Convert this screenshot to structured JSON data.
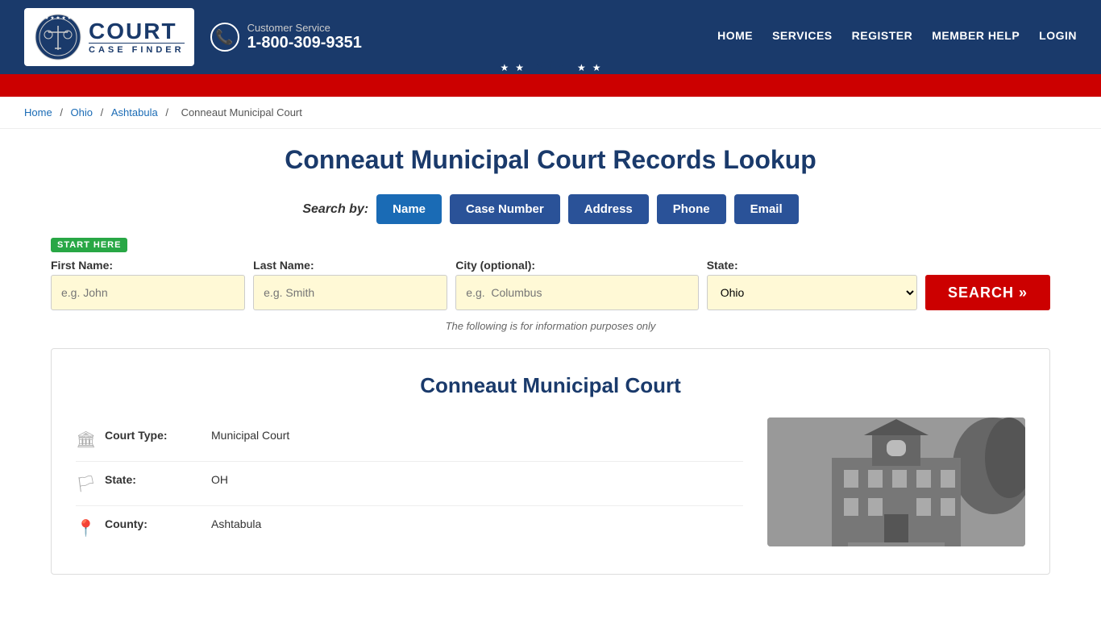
{
  "header": {
    "logo": {
      "court_text": "COURT",
      "case_finder_text": "CASE FINDER"
    },
    "customer_service": {
      "label": "Customer Service",
      "phone": "1-800-309-9351"
    },
    "nav": [
      {
        "id": "home",
        "label": "HOME"
      },
      {
        "id": "services",
        "label": "SERVICES"
      },
      {
        "id": "register",
        "label": "REGISTER"
      },
      {
        "id": "member-help",
        "label": "MEMBER HELP"
      },
      {
        "id": "login",
        "label": "LOGIN"
      }
    ]
  },
  "breadcrumb": {
    "items": [
      "Home",
      "Ohio",
      "Ashtabula",
      "Conneaut Municipal Court"
    ],
    "separators": [
      "/",
      "/",
      "/"
    ]
  },
  "page": {
    "title": "Conneaut Municipal Court Records Lookup",
    "search_by_label": "Search by:",
    "search_tabs": [
      {
        "id": "name",
        "label": "Name",
        "active": true
      },
      {
        "id": "case-number",
        "label": "Case Number",
        "active": false
      },
      {
        "id": "address",
        "label": "Address",
        "active": false
      },
      {
        "id": "phone",
        "label": "Phone",
        "active": false
      },
      {
        "id": "email",
        "label": "Email",
        "active": false
      }
    ],
    "start_here_badge": "START HERE",
    "form": {
      "first_name_label": "First Name:",
      "first_name_placeholder": "e.g. John",
      "last_name_label": "Last Name:",
      "last_name_placeholder": "e.g. Smith",
      "city_label": "City (optional):",
      "city_placeholder": "e.g.  Columbus",
      "state_label": "State:",
      "state_value": "Ohio",
      "search_button": "SEARCH »"
    },
    "info_note": "The following is for information purposes only"
  },
  "court_card": {
    "title": "Conneaut Municipal Court",
    "details": [
      {
        "icon": "building-icon",
        "label": "Court Type:",
        "value": "Municipal Court"
      },
      {
        "icon": "flag-icon",
        "label": "State:",
        "value": "OH"
      },
      {
        "icon": "map-pin-icon",
        "label": "County:",
        "value": "Ashtabula"
      }
    ]
  }
}
